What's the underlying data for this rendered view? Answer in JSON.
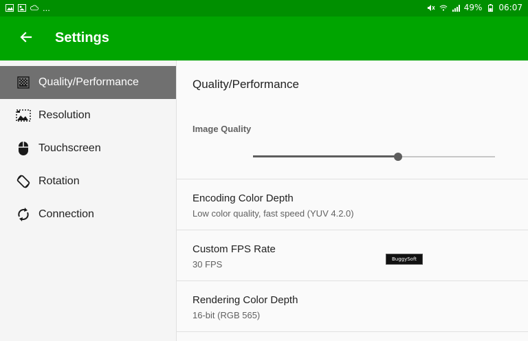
{
  "status_bar": {
    "more_indicator": "...",
    "battery": "49%",
    "time": "06:07",
    "icons": [
      "image-icon",
      "gallery-icon",
      "cloud-icon",
      "mute-icon",
      "wifi-icon",
      "signal-icon",
      "battery-icon"
    ]
  },
  "app_bar": {
    "title": "Settings",
    "back_icon": "arrow-left-icon",
    "color": "#00a500"
  },
  "sidebar": {
    "items": [
      {
        "label": "Quality/Performance",
        "icon": "quality-icon",
        "active": true
      },
      {
        "label": "Resolution",
        "icon": "resolution-icon",
        "active": false
      },
      {
        "label": "Touchscreen",
        "icon": "mouse-icon",
        "active": false
      },
      {
        "label": "Rotation",
        "icon": "rotation-icon",
        "active": false
      },
      {
        "label": "Connection",
        "icon": "sync-icon",
        "active": false
      }
    ]
  },
  "main": {
    "section_title": "Quality/Performance",
    "image_quality": {
      "label": "Image Quality",
      "value_fraction": 0.6
    },
    "prefs": [
      {
        "title": "Encoding Color Depth",
        "summary": "Low color quality, fast speed (YUV 4.2.0)"
      },
      {
        "title": "Custom FPS Rate",
        "summary": "30 FPS"
      },
      {
        "title": "Rendering Color Depth",
        "summary": "16-bit (RGB 565)"
      }
    ]
  },
  "watermark": {
    "text": "BuggySoft"
  }
}
